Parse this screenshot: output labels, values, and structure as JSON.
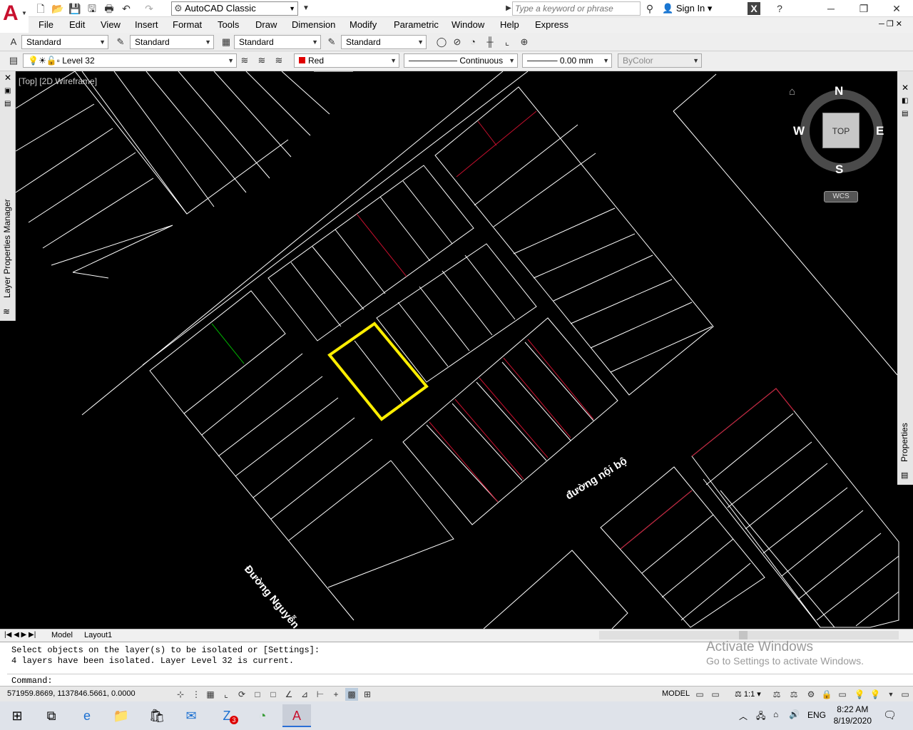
{
  "app": {
    "workspace": "AutoCAD Classic",
    "search_placeholder": "Type a keyword or phrase",
    "sign_in": "Sign In",
    "logo_letter": "A"
  },
  "menus": [
    "File",
    "Edit",
    "View",
    "Insert",
    "Format",
    "Tools",
    "Draw",
    "Dimension",
    "Modify",
    "Parametric",
    "Window",
    "Help",
    "Express"
  ],
  "styles": {
    "text_style": "Standard",
    "dim_style": "Standard",
    "table_style": "Standard",
    "mleader_style": "Standard"
  },
  "layers": {
    "current_layer": "Level 32",
    "color": "Red",
    "linetype": "Continuous",
    "lineweight": "0.00 mm",
    "plot_style": "ByColor"
  },
  "viewport": {
    "label": "[Top] [2D Wireframe]"
  },
  "viewcube": {
    "n": "N",
    "s": "S",
    "e": "E",
    "w": "W",
    "face": "TOP",
    "wcs": "WCS"
  },
  "palettes": {
    "layer_manager": "Layer Properties Manager",
    "properties": "Properties"
  },
  "drawing_text": {
    "road_internal": "đường nội bộ",
    "road_main": "Đường Nguyễn"
  },
  "tabs": {
    "model": "Model",
    "layout1": "Layout1"
  },
  "command": {
    "line1": "Select objects on the layer(s) to be isolated or [Settings]:",
    "line2": "4 layers have been isolated. Layer Level 32 is current.",
    "prompt": "Command:"
  },
  "status": {
    "coords": "571959.8669, 1137846.5661, 0.0000",
    "model": "MODEL",
    "scale": "1:1"
  },
  "watermark": {
    "title": "Activate Windows",
    "sub": "Go to Settings to activate Windows."
  },
  "taskbar": {
    "lang": "ENG",
    "time": "8:22 AM",
    "date": "8/19/2020",
    "badge": "3"
  },
  "colors": {
    "selection": "#ffee00",
    "red_lines": "#c8102e",
    "green_line": "#00b000",
    "lines": "#ffffff"
  }
}
